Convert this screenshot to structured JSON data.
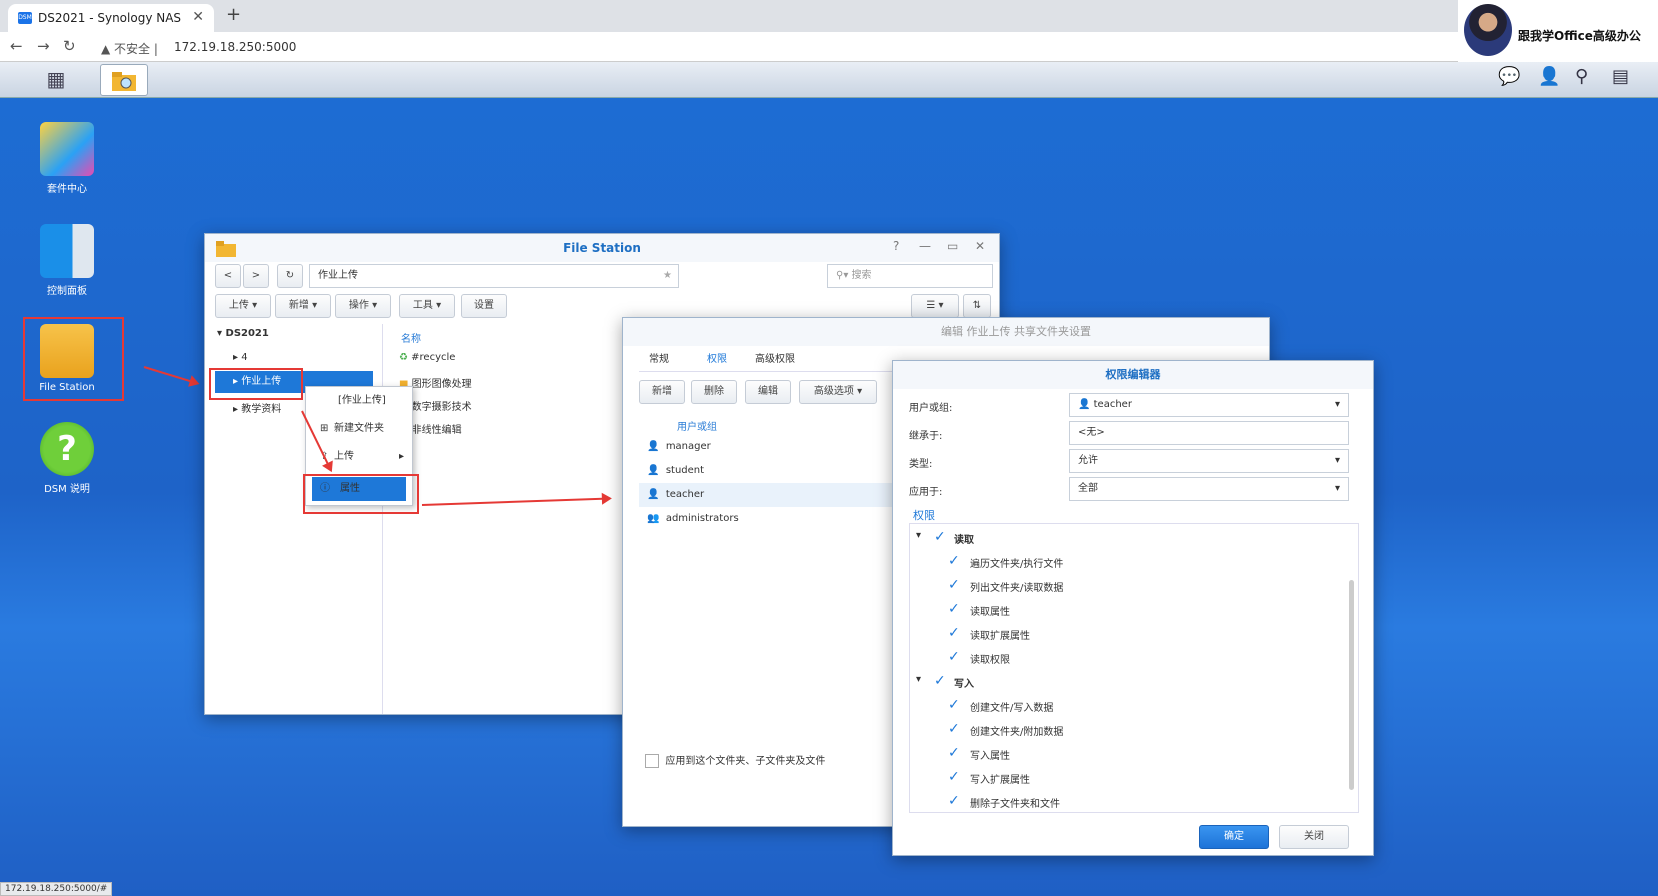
{
  "browser": {
    "tab_title": "DS2021 - Synology NAS",
    "tab_close": "✕",
    "new_tab": "+",
    "security": "不安全",
    "url": "172.19.18.250:5000",
    "profile_name": "跟我学Office高级办公",
    "status_url": "172.19.18.250:5000/#"
  },
  "desktop": {
    "icons": [
      {
        "label": "套件中心"
      },
      {
        "label": "控制面板"
      },
      {
        "label": "File Station"
      },
      {
        "label": "DSM 说明"
      }
    ]
  },
  "file_station": {
    "title": "File Station",
    "path": "作业上传",
    "search_placeholder": "搜索",
    "toolbar": [
      "上传",
      "新增",
      "操作",
      "工具",
      "设置"
    ],
    "tree_root": "DS2021",
    "tree_items": [
      "4",
      "作业上传",
      "教学资料"
    ],
    "column_name": "名称",
    "files": [
      "#recycle",
      "图形图像处理",
      "数字摄影技术",
      "非线性编辑"
    ]
  },
  "context_menu": {
    "header": "[作业上传]",
    "items": [
      "新建文件夹",
      "上传",
      "属性"
    ]
  },
  "share_dialog": {
    "title": "编辑 作业上传 共享文件夹设置",
    "tabs": [
      "常规",
      "权限",
      "高级权限"
    ],
    "buttons": [
      "新增",
      "删除",
      "编辑",
      "高级选项"
    ],
    "column": "用户或组",
    "users": [
      "manager",
      "student",
      "teacher",
      "administrators"
    ],
    "apply_checkbox": "应用到这个文件夹、子文件夹及文件"
  },
  "perm_editor": {
    "title": "权限编辑器",
    "fields": [
      {
        "label": "用户或组:",
        "value": "teacher"
      },
      {
        "label": "继承于:",
        "value": "<无>"
      },
      {
        "label": "类型:",
        "value": "允许"
      },
      {
        "label": "应用于:",
        "value": "全部"
      }
    ],
    "section": "权限",
    "groups": [
      {
        "name": "读取",
        "items": [
          "遍历文件夹/执行文件",
          "列出文件夹/读取数据",
          "读取属性",
          "读取扩展属性",
          "读取权限"
        ]
      },
      {
        "name": "写入",
        "items": [
          "创建文件/写入数据",
          "创建文件夹/附加数据",
          "写入属性",
          "写入扩展属性",
          "删除子文件夹和文件"
        ]
      }
    ],
    "ok": "确定",
    "close": "关闭"
  },
  "colors": {
    "accent": "#1e78d8",
    "highlight": "#e53935"
  }
}
